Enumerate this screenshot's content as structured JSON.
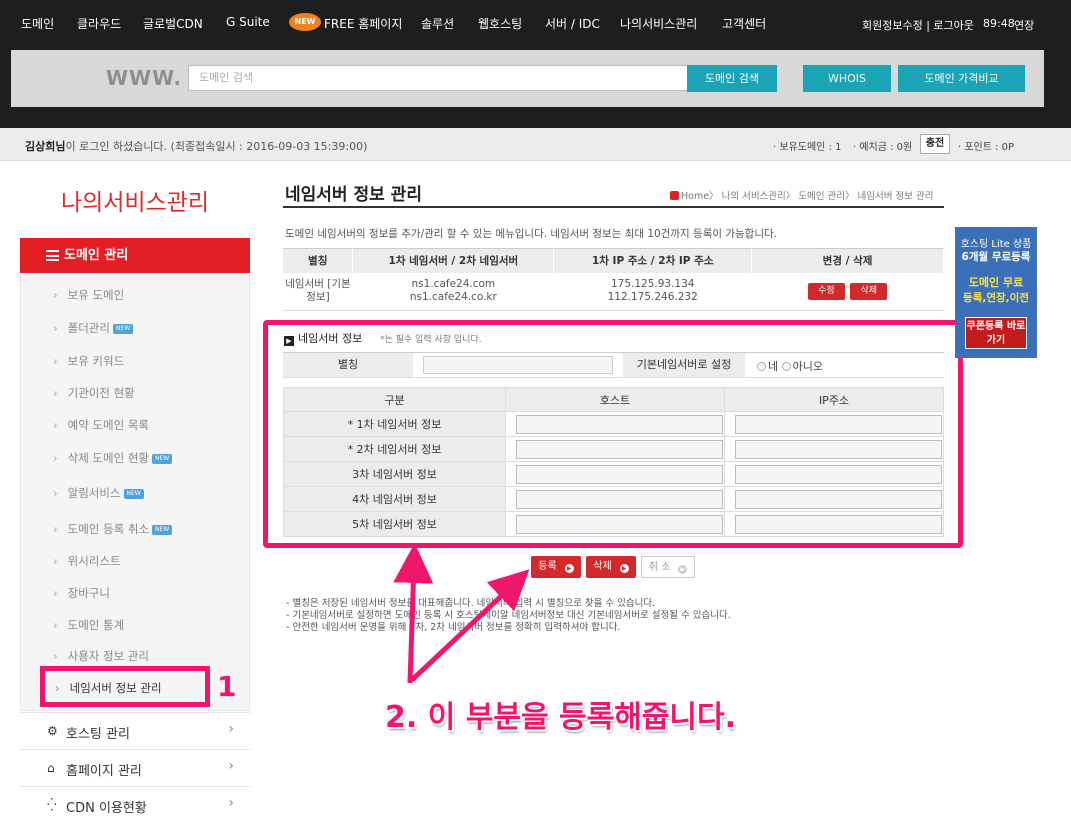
{
  "nav": {
    "items": [
      "도메인",
      "클라우드",
      "글로벌CDN",
      "G Suite",
      "FREE 홈페이지",
      "솔루션",
      "웹호스팅",
      "서버 / IDC",
      "나의서비스관리",
      "고객센터"
    ],
    "new_badge": "NEW",
    "account": "회원정보수정 | 로그아웃",
    "timer": "89:48",
    "extend": "연장"
  },
  "search": {
    "www": "WWW.",
    "placeholder": "도메인 검색",
    "search_btn": "도메인 검색",
    "whois_btn": "WHOIS",
    "compare_btn": "도메인 가격비교"
  },
  "login": {
    "user": "김상희님",
    "message": "이 로그인 하셨습니다. (최종접속일시 : 2016-09-03 15:39:00)",
    "owned": "· 보유도메인 : 1",
    "deposit": "· 예치금 : 0원",
    "charge": "충전",
    "points": "· 포인트 : 0P"
  },
  "sidebar": {
    "title": "나의서비스관리",
    "section": "도메인 관리",
    "items": [
      {
        "label": "보유 도메인",
        "new": false
      },
      {
        "label": "폴더관리",
        "new": true
      },
      {
        "label": "보유 키워드",
        "new": false
      },
      {
        "label": "기관이전 현황",
        "new": false
      },
      {
        "label": "예약 도메인 목록",
        "new": false
      },
      {
        "label": "삭제 도메인 현황",
        "new": true
      },
      {
        "label": "알림서비스",
        "new": true
      },
      {
        "label": "도메인 등록 취소",
        "new": true
      },
      {
        "label": "위시리스트",
        "new": false
      },
      {
        "label": "장바구니",
        "new": false
      },
      {
        "label": "도메인 통계",
        "new": false
      },
      {
        "label": "사용자 정보 관리",
        "new": false
      }
    ],
    "active": "네임서버 정보 관리",
    "annotation": "1",
    "groups": [
      "호스팅 관리",
      "홈페이지 관리",
      "CDN 이용현황"
    ]
  },
  "main": {
    "title": "네임서버 정보 관리",
    "breadcrumb": "Home〉 나의 서비스관리〉 도메인 관리〉 네임서버 정보 관리",
    "description": "도메인 네임서버의 정보를 추가/관리 할 수 있는 메뉴입니다. 네임서버 정보는 최대 10건까지 등록이 가능합니다.",
    "table": {
      "headers": [
        "별칭",
        "1차 네임서버 / 2차 네임서버",
        "1차 IP 주소 / 2차 IP 주소",
        "변경 / 삭제"
      ],
      "row": {
        "alias": "네임서버 [기본정보]",
        "ns1": "ns1.cafe24.com",
        "ns2": "ns1.cafe24.co.kr",
        "ip1": "175.125.93.134",
        "ip2": "112.175.246.232",
        "edit": "수정",
        "delete": "삭제"
      }
    },
    "form": {
      "heading": "네임서버 정보",
      "note": "*는 필수 입력 사항 입니다.",
      "alias_label": "별칭",
      "default_label": "기본네임서버로 설정",
      "yes": "네",
      "no": "아니오",
      "grid_headers": [
        "구분",
        "호스트",
        "IP주소"
      ],
      "rows": [
        "* 1차 네임서버 정보",
        "* 2차 네임서버 정보",
        "3차 네임서버 정보",
        "4차 네임서버 정보",
        "5차 네임서버 정보"
      ]
    },
    "buttons": {
      "register": "등록",
      "delete": "삭제",
      "cancel": "취 소"
    },
    "notes": [
      "- 별칭은 저장된 네임서버 정보를 대표해줍니다. 네임서버 입력 시 별칭으로 찾을 수 있습니다.",
      "- 기본네임서버로 설정하면 도메인 등록 시 호스팅케이알 네임서버정보 대신 기본네임서버로 설정될 수 있습니다.",
      "- 안전한 네임서버 운영을 위해 1차, 2차 네임서버 정보를 정확히 입력하셔야 합니다."
    ],
    "callout": "2. 이 부분을 등록해줍니다."
  },
  "ad": {
    "line1": "호스팅 Lite 상품",
    "line2": "6개월 무료등록",
    "line3": "도메인 무료",
    "line4": "등록,연장,이전",
    "button": "쿠폰등록 바로가기"
  },
  "colors": {
    "accent_red": "#e31e24",
    "highlight_pink": "#f0166e",
    "teal": "#1aa4b5"
  }
}
